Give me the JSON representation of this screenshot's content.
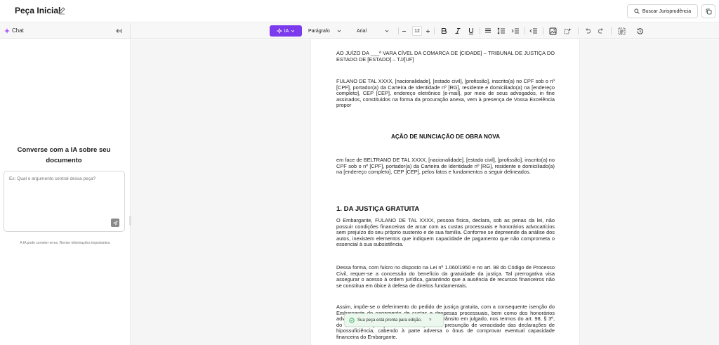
{
  "header": {
    "title": "Peça Inicial",
    "search_button": "Buscar Jurisprudência"
  },
  "chat": {
    "tab_label": "Chat",
    "heading_line1": "Converse com a IA sobre seu",
    "heading_line2": "documento",
    "input_placeholder": "Ex: Qual o argumento central dessa peça?",
    "disclaimer": "A IA pode cometer erros. Revise informações importantes."
  },
  "toolbar": {
    "ia_label": "IA",
    "paragraph_style": "Parágrafo",
    "font_family": "Arial",
    "font_size": "12",
    "accent_color": "#7c3aed"
  },
  "document": {
    "address": "AO JUÍZO DA ___ª VARA CÍVEL DA COMARCA DE [CIDADE] – TRIBUNAL DE JUSTIÇA DO ESTADO DE [ESTADO] – TJ/[UF]",
    "party": "FULANO DE TAL XXXX, [nacionalidade], [estado civil], [profissão], inscrito(a) no CPF sob o nº [CPF], portador(a) da Carteira de Identidade nº [RG], residente e domiciliado(a) na [endereço completo], CEP [CEP], endereço eletrônico [e-mail], por meio de seus advogados, in fine assinados, constituídos na forma da procuração anexa, vem à presença de Vossa Excelência propor",
    "action_title": "AÇÃO DE NUNCIAÇÃO DE OBRA NOVA",
    "defendant": "em face de BELTRANO DE TAL XXXX, [nacionalidade], [estado civil], [profissão], inscrito(a) no CPF sob o nº [CPF], portador(a) da Carteira de Identidade nº [RG], residente e domiciliado(a) na [endereço completo], CEP [CEP], pelos fatos e fundamentos a seguir delineados.",
    "section1_title": "1. DA JUSTIÇA GRATUITA",
    "section1_p1": "O Embargante, FULANO DE TAL XXXX, pessoa física, declara, sob as penas da lei, não possuir condições financeiras de arcar com as custas processuais e honorários advocatícios sem prejuízo do seu próprio sustento e de sua família. Conforme se depreende da análise dos autos, inexistem elementos que indiquem capacidade de pagamento que não comprometa o essencial à sua subsistência.",
    "section1_p2": "Dessa forma, com fulcro no disposto na Lei nº 1.060/1950 e no art. 98 do Código de Processo Civil, requer-se a concessão do benefício da gratuidade da justiça. Tal prerrogativa visa assegurar o acesso à ordem jurídica, garantindo que a ausência de recursos financeiros não se constitua em óbice à defesa de direitos fundamentais.",
    "section1_p3": "Assim, impõe-se o deferimento do pedido de justiça gratuita, com a consequente isenção do Embargante do pagamento de custas e despesas processuais, bem como dos honorários advocatícios, até o final do processo após o trânsito em julgado, nos termos do art. 98, § 3º, do CPC. A estipulação encontra amparo na presunção de veracidade das declarações de hipossuficiência, cabendo à parte adversa o ônus de comprovar eventual capacidade financeira do Embargante."
  },
  "toast": {
    "message": "Sua peça está pronta para edição."
  }
}
